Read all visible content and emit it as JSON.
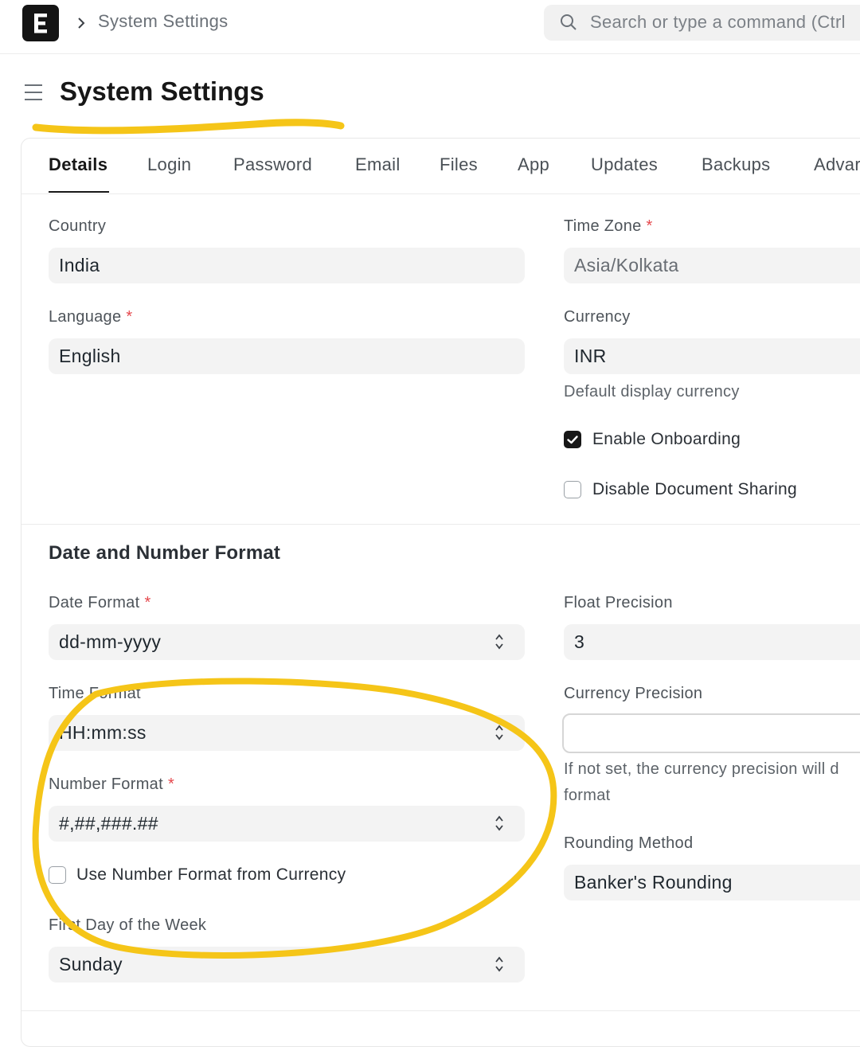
{
  "header": {
    "breadcrumb": "System Settings",
    "search_placeholder": "Search or type a command (Ctrl"
  },
  "page": {
    "title": "System Settings"
  },
  "tabs": [
    "Details",
    "Login",
    "Password",
    "Email",
    "Files",
    "App",
    "Updates",
    "Backups",
    "Advar"
  ],
  "active_tab": "Details",
  "details": {
    "country": {
      "label": "Country",
      "value": "India"
    },
    "time_zone": {
      "label": "Time Zone",
      "value": "Asia/Kolkata",
      "required": true
    },
    "language": {
      "label": "Language",
      "value": "English",
      "required": true
    },
    "currency": {
      "label": "Currency",
      "value": "INR",
      "description": "Default display currency"
    },
    "enable_onboarding": {
      "label": "Enable Onboarding",
      "checked": true
    },
    "disable_document_sharing": {
      "label": "Disable Document Sharing",
      "checked": false
    }
  },
  "date_number_section": {
    "title": "Date and Number Format",
    "date_format": {
      "label": "Date Format",
      "value": "dd-mm-yyyy",
      "required": true
    },
    "time_format": {
      "label": "Time Format",
      "value": "HH:mm:ss"
    },
    "number_format": {
      "label": "Number Format",
      "value": "#,##,###.##",
      "required": true
    },
    "use_number_format_from_currency": {
      "label": "Use Number Format from Currency",
      "checked": false
    },
    "first_day_of_week": {
      "label": "First Day of the Week",
      "value": "Sunday"
    },
    "float_precision": {
      "label": "Float Precision",
      "value": "3"
    },
    "currency_precision": {
      "label": "Currency Precision",
      "value": "",
      "description_line1": "If not set, the currency precision will d",
      "description_line2": "format"
    },
    "rounding_method": {
      "label": "Rounding Method",
      "value": "Banker's Rounding"
    }
  },
  "required_marker": "*",
  "colors": {
    "accent_highlight": "#f5c518",
    "required": "#e5484d",
    "checkbox_checked": "#171717"
  },
  "icons": [
    "app-logo-icon",
    "chevron-right-icon",
    "search-icon",
    "hamburger-menu-icon",
    "select-arrows-icon",
    "check-icon"
  ]
}
